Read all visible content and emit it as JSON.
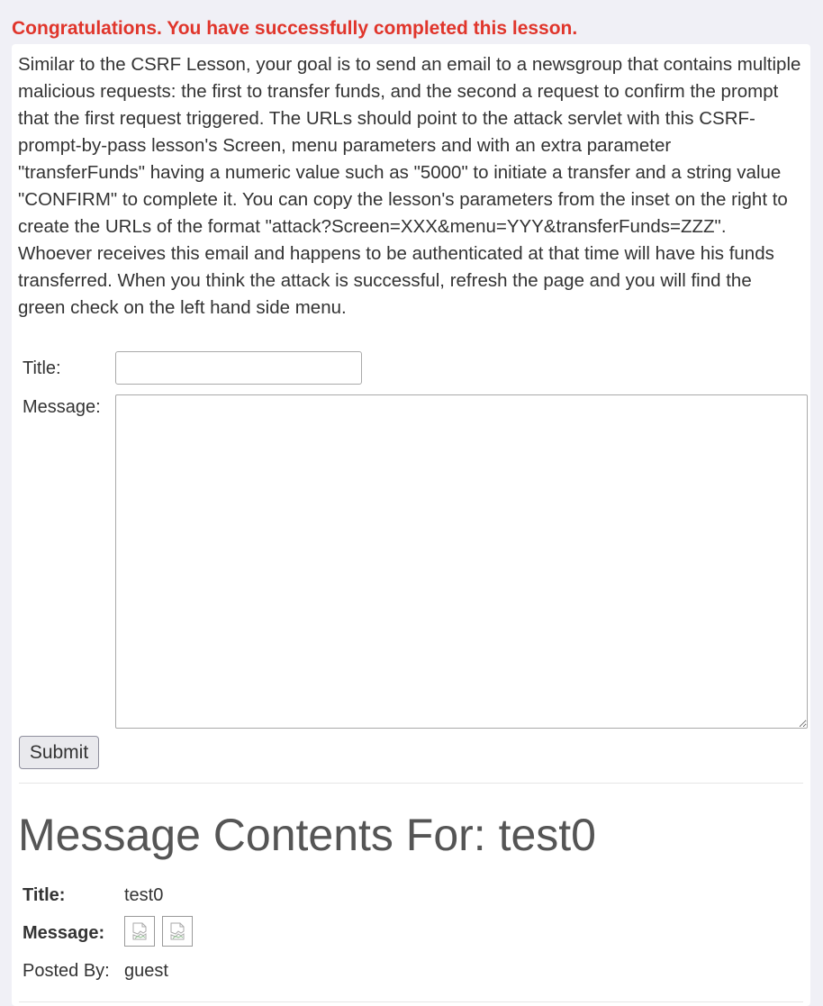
{
  "status_message": "Congratulations. You have successfully completed this lesson.",
  "instructions": "Similar to the CSRF Lesson, your goal is to send an email to a newsgroup that contains multiple malicious requests: the first to transfer funds, and the second a request to confirm the prompt that the first request triggered. The URLs should point to the attack servlet with this CSRF-prompt-by-pass lesson's Screen, menu parameters and with an extra parameter \"transferFunds\" having a numeric value such as \"5000\" to initiate a transfer and a string value \"CONFIRM\" to complete it. You can copy the lesson's parameters from the inset on the right to create the URLs of the format \"attack?Screen=XXX&menu=YYY&transferFunds=ZZZ\". Whoever receives this email and happens to be authenticated at that time will have his funds transferred. When you think the attack is successful, refresh the page and you will find the green check on the left hand side menu.",
  "form": {
    "title_label": "Title:",
    "title_value": "",
    "message_label": "Message:",
    "message_value": "",
    "submit_label": "Submit"
  },
  "message_contents": {
    "heading": "Message Contents For: test0",
    "title_label": "Title:",
    "title_value": "test0",
    "message_label": "Message:",
    "message_images": [
      "broken-image-icon",
      "broken-image-icon"
    ],
    "posted_by_label": "Posted By:",
    "posted_by_value": "guest"
  },
  "colors": {
    "success_text": "#e0352b",
    "page_background": "#f0f0f6",
    "panel_background": "#ffffff"
  }
}
